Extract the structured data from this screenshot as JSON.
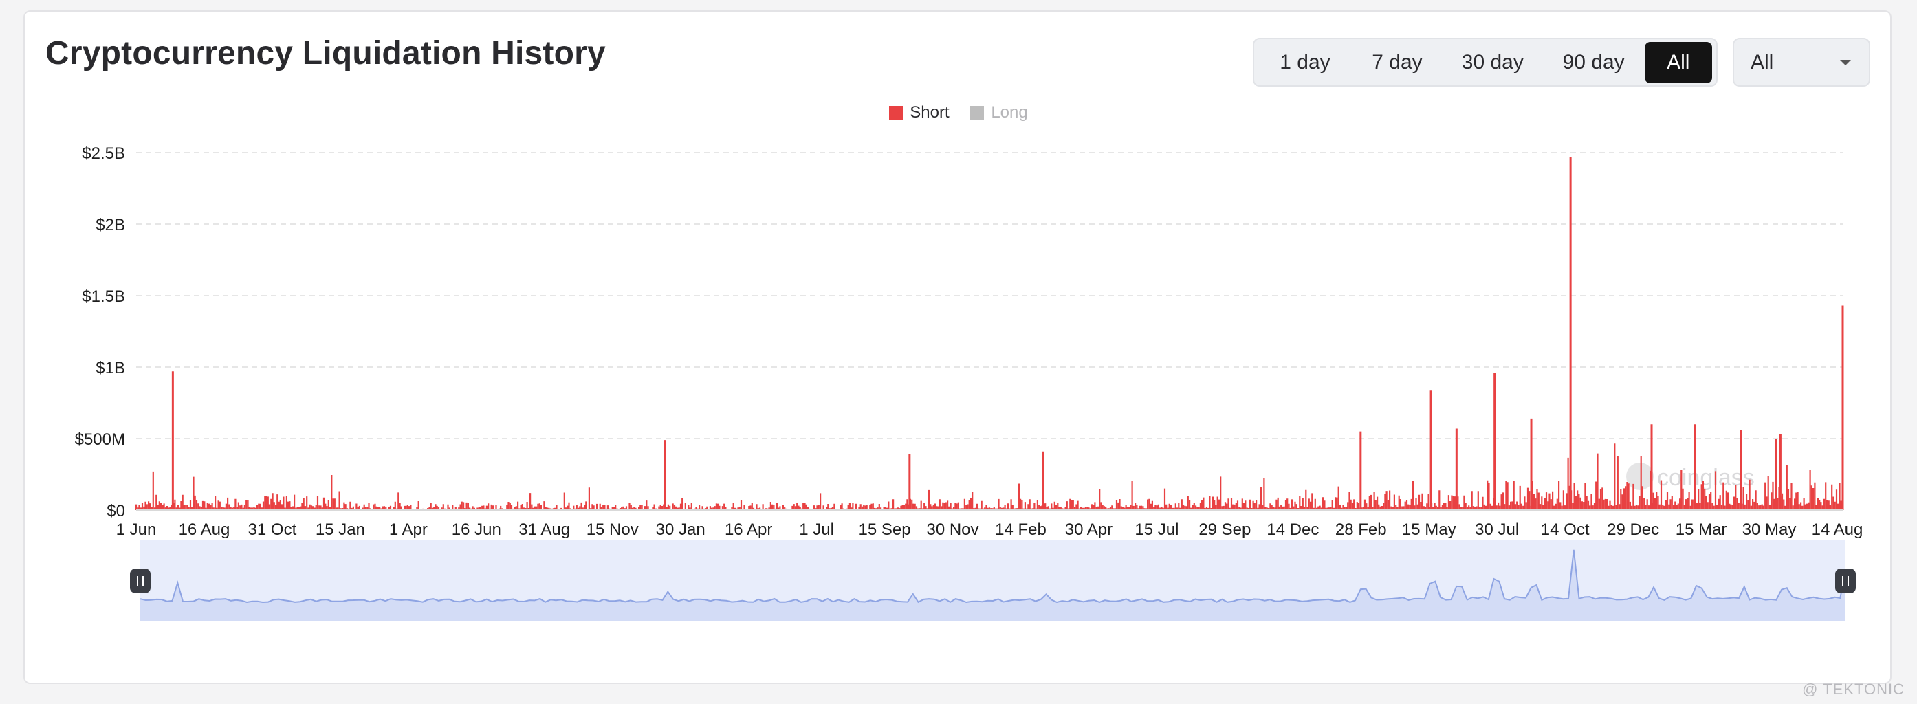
{
  "header": {
    "title": "Cryptocurrency Liquidation History",
    "range_options": [
      "1 day",
      "7 day",
      "30 day",
      "90 day",
      "All"
    ],
    "active_range": "All",
    "select_value": "All"
  },
  "legend": [
    {
      "label": "Short",
      "color": "#e84142",
      "active": true
    },
    {
      "label": "Long",
      "color": "#bdbdbd",
      "active": false
    }
  ],
  "colors": {
    "short": "#e84142",
    "navigator_fill": "#e8edfb",
    "navigator_line": "#8ea4e3",
    "grid": "#e6e6e6"
  },
  "watermark": "coinglass",
  "corner_credit": "@ TEKTONIC",
  "chart_data": {
    "type": "bar",
    "series": [
      {
        "name": "Short",
        "note": "daily short liquidations (USD); notable spikes read from chart",
        "spikes": [
          {
            "x": 0.0215,
            "value": 970000000
          },
          {
            "x": 0.3097,
            "value": 490000000
          },
          {
            "x": 0.4532,
            "value": 390000000
          },
          {
            "x": 0.5315,
            "value": 410000000
          },
          {
            "x": 0.7175,
            "value": 550000000
          },
          {
            "x": 0.7587,
            "value": 840000000
          },
          {
            "x": 0.7737,
            "value": 570000000
          },
          {
            "x": 0.796,
            "value": 960000000
          },
          {
            "x": 0.8175,
            "value": 640000000
          },
          {
            "x": 0.8405,
            "value": 2470000000
          },
          {
            "x": 0.888,
            "value": 600000000
          },
          {
            "x": 0.9132,
            "value": 600000000
          },
          {
            "x": 0.9405,
            "value": 560000000
          },
          {
            "x": 0.9635,
            "value": 530000000
          },
          {
            "x": 1.0,
            "value": 1430000000
          }
        ]
      }
    ],
    "x_tick_labels": [
      "1 Jun",
      "16 Aug",
      "31 Oct",
      "15 Jan",
      "1 Apr",
      "16 Jun",
      "31 Aug",
      "15 Nov",
      "30 Jan",
      "16 Apr",
      "1 Jul",
      "15 Sep",
      "30 Nov",
      "14 Feb",
      "30 Apr",
      "15 Jul",
      "29 Sep",
      "14 Dec",
      "28 Feb",
      "15 May",
      "30 Jul",
      "14 Oct",
      "29 Dec",
      "15 Mar",
      "30 May",
      "14 Aug"
    ],
    "y_ticks": [
      {
        "value": 0,
        "label": "$0"
      },
      {
        "value": 500000000,
        "label": "$500M"
      },
      {
        "value": 1000000000,
        "label": "$1B"
      },
      {
        "value": 1500000000,
        "label": "$1.5B"
      },
      {
        "value": 2000000000,
        "label": "$2B"
      },
      {
        "value": 2500000000,
        "label": "$2.5B"
      }
    ],
    "ylim": [
      0,
      2500000000
    ],
    "grid": true,
    "legend_position": "top-center",
    "has_navigator": true
  }
}
